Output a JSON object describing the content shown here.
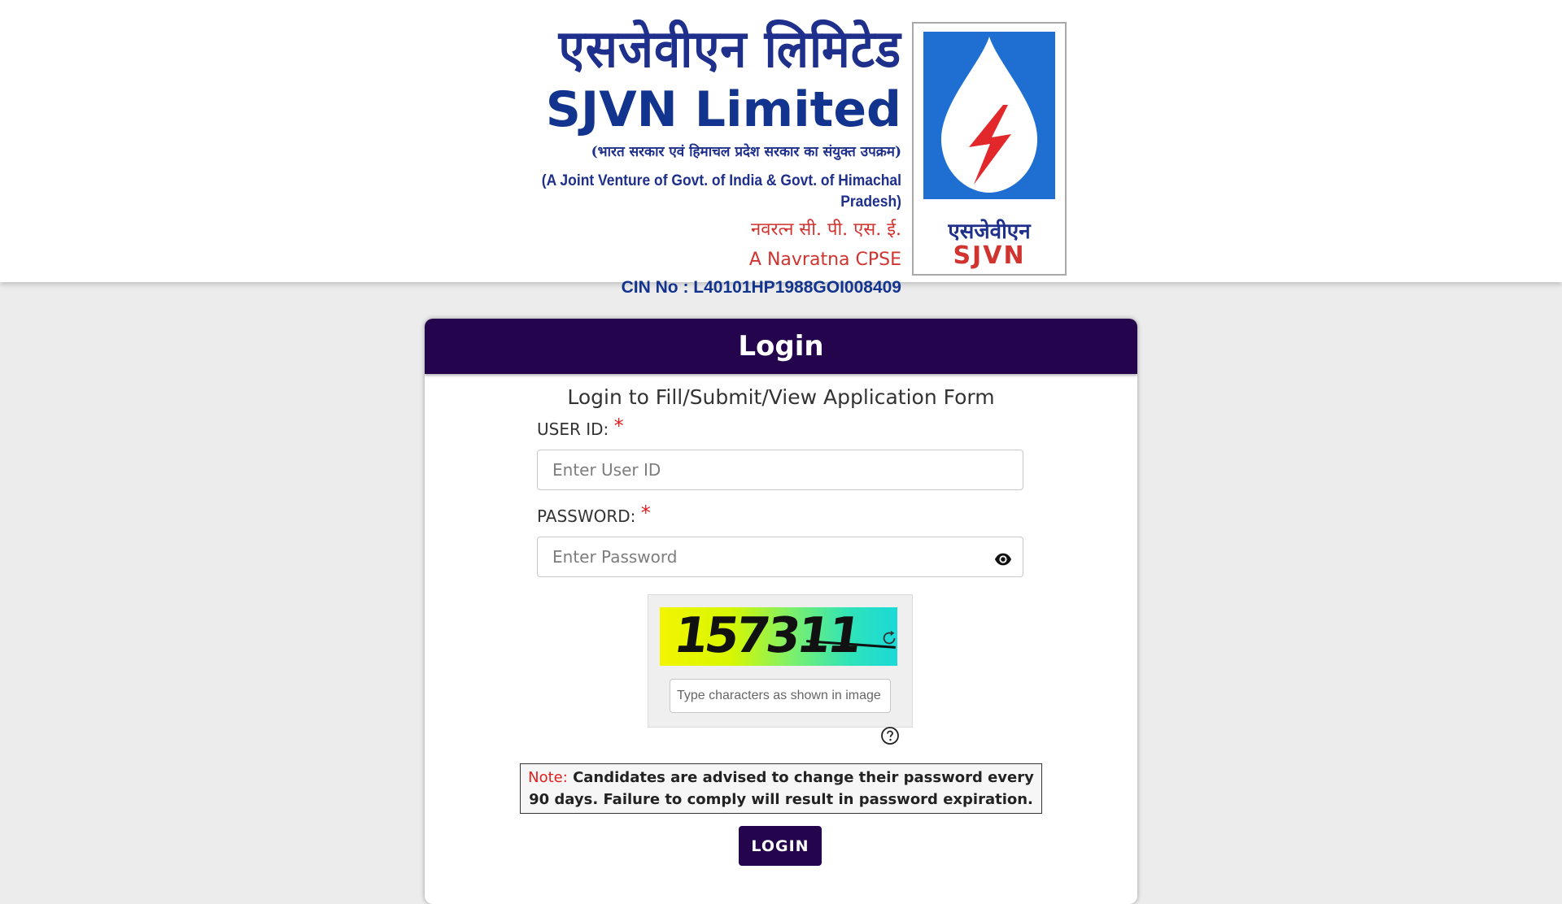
{
  "header": {
    "hindi_name": "एसजेवीएन लिमिटेड",
    "english_name": "SJVN Limited",
    "hindi_subtitle": "(भारत सरकार एवं हिमाचल प्रदेश सरकार का संयुक्त उपक्रम)",
    "english_subtitle": "(A Joint Venture of Govt. of India & Govt. of Himachal Pradesh)",
    "navratna_hindi": "नवरत्न सी. पी. एस. ई.",
    "navratna_english": "A Navratna CPSE",
    "cin": "CIN No : L40101HP1988GOI008409",
    "badge_hindi": "एसजेवीएन",
    "badge_english": "SJVN"
  },
  "login": {
    "title": "Login",
    "subtitle": "Login to Fill/Submit/View Application Form",
    "user_id_label": "USER ID:",
    "user_id_placeholder": "Enter User ID",
    "password_label": "PASSWORD:",
    "password_placeholder": "Enter Password",
    "required_marker": "*",
    "captcha_text": "157311",
    "captcha_placeholder": "Type characters as shown in image",
    "note_label": "Note:",
    "note_text": " Candidates are advised to change their password every 90 days. Failure to comply will result in password expiration.",
    "login_button": "LOGIN"
  },
  "colors": {
    "brand_dark": "#24044d",
    "logo_blue": "#13348e",
    "logo_red": "#d1332f",
    "required_red": "#e0201f"
  },
  "icons": [
    "eye-icon",
    "refresh-icon",
    "help-icon",
    "sjvn-logo-icon"
  ]
}
